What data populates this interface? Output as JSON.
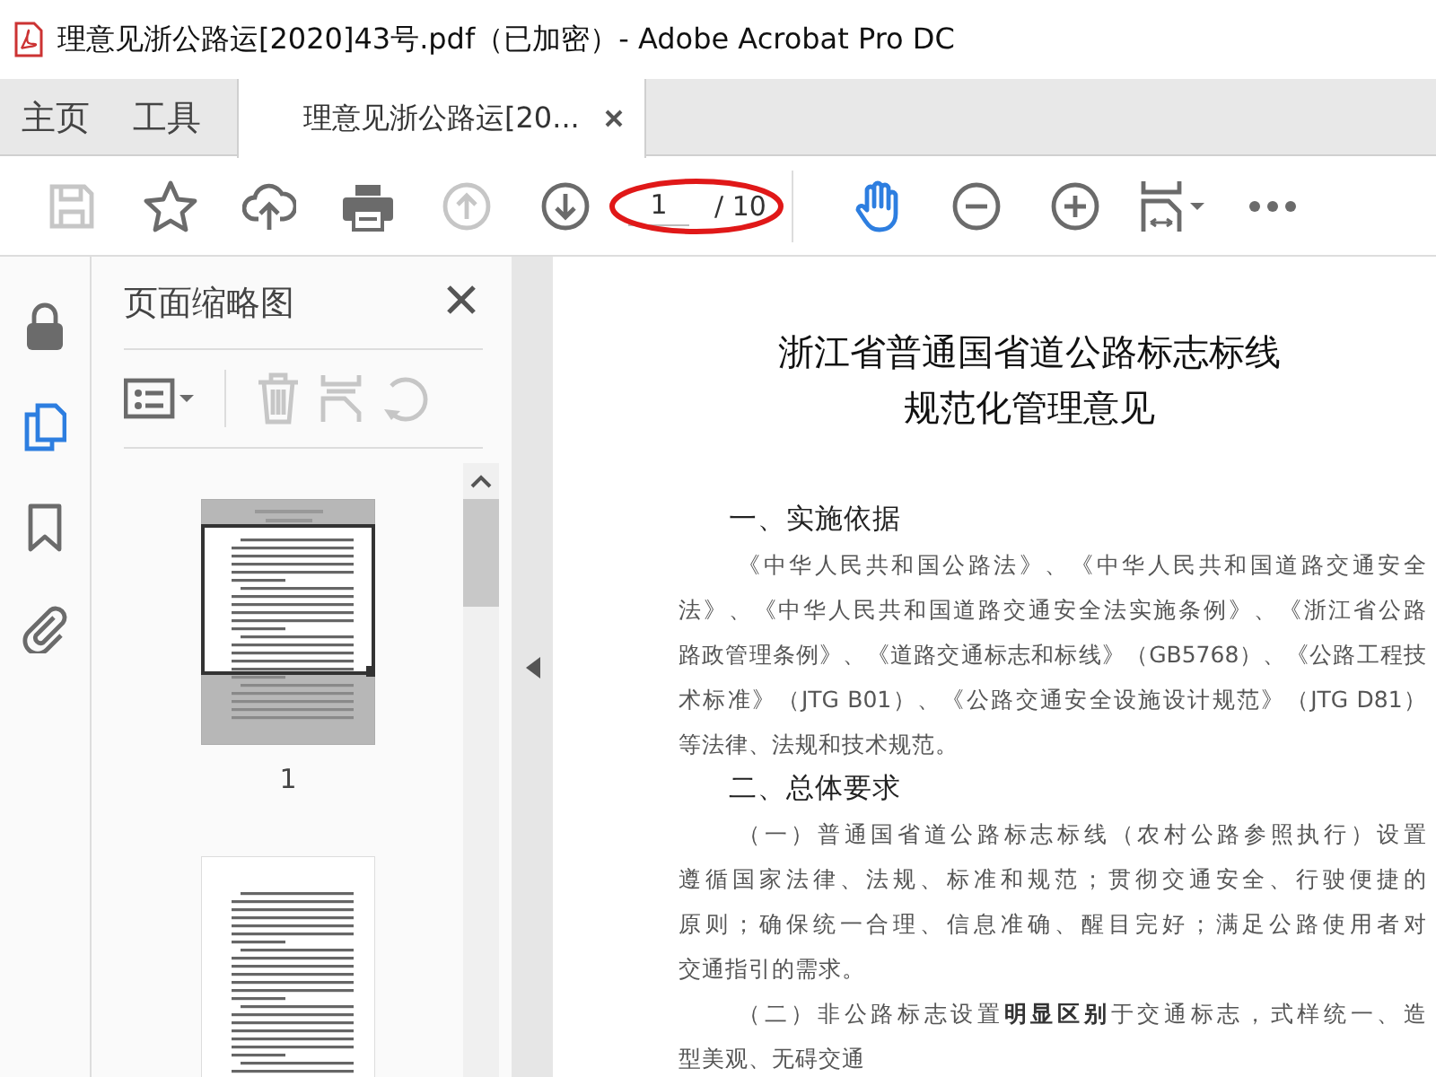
{
  "window": {
    "title": "理意见浙公路运[2020]43号.pdf（已加密）- Adobe Acrobat Pro DC"
  },
  "tabs": [
    {
      "label": "主页",
      "selected": false,
      "closable": false
    },
    {
      "label": "工具",
      "selected": false,
      "closable": false
    },
    {
      "label": "理意见浙公路运[20...",
      "selected": true,
      "closable": true
    }
  ],
  "toolbar": {
    "left_tools": [
      {
        "kind": "save",
        "disabled": true,
        "selected": false
      },
      {
        "kind": "star",
        "disabled": false,
        "selected": false
      },
      {
        "kind": "upload",
        "disabled": false,
        "selected": false
      },
      {
        "kind": "print",
        "disabled": false,
        "selected": false
      },
      {
        "kind": "prev",
        "disabled": true,
        "selected": false
      },
      {
        "kind": "next",
        "disabled": false,
        "selected": false
      }
    ],
    "page_field": {
      "value": "1",
      "total": "/ 10",
      "circled": true
    },
    "right_tools": [
      {
        "kind": "hand",
        "disabled": false,
        "selected": true
      },
      {
        "kind": "zoom_out",
        "disabled": false,
        "selected": false
      },
      {
        "kind": "zoom_in",
        "disabled": false,
        "selected": false
      },
      {
        "kind": "fit",
        "disabled": false,
        "selected": false
      },
      {
        "kind": "more",
        "disabled": false,
        "selected": false
      }
    ]
  },
  "rail": [
    {
      "kind": "lock",
      "selected": false
    },
    {
      "kind": "pages",
      "selected": true
    },
    {
      "kind": "bookmark",
      "selected": false
    },
    {
      "kind": "attachment",
      "selected": false
    }
  ],
  "thumbnail_panel": {
    "title": "页面缩略图",
    "tools": [
      {
        "kind": "options",
        "disabled": false
      },
      {
        "kind": "delete",
        "disabled": true
      },
      {
        "kind": "extract",
        "disabled": true
      },
      {
        "kind": "rotate",
        "disabled": true
      }
    ],
    "thumbnails": [
      {
        "label": "1",
        "selected": true
      },
      {
        "selected": false
      }
    ]
  },
  "document": {
    "title": [
      "浙江省普通国省道公路标志标线",
      "规范化管理意见"
    ],
    "sections": [
      {
        "kind": "heading",
        "text": "一、实施依据"
      },
      {
        "kind": "paragraph",
        "lines": [
          "《中华人民共和国公路法》、《中华人民共和国道路交通安全",
          "法》、《中华人民共和国道路交通安全法实施条例》、《浙江省公路",
          "路政管理条例》、《道路交通标志和标线》（GB5768）、《公路工程技",
          "术标准》（JTG B01）、《公路交通安全设施设计规范》（JTG D81）",
          "等法律、法规和技术规范。"
        ]
      },
      {
        "kind": "heading",
        "text": "二、总体要求"
      },
      {
        "kind": "paragraph",
        "lines": [
          "（一）普通国省道公路标志标线（农村公路参照执行）设置",
          "遵循国家法律、法规、标准和规范；贯彻交通安全、行驶便捷的",
          "原则；确保统一合理、信息准确、醒目完好；满足公路使用者对",
          "交通指引的需求。"
        ]
      },
      {
        "kind": "paragraph",
        "lines": [
          "（二）非公路标志设置**明显区别**于交通标志，式样统一、造",
          "型美观、无碍交通"
        ]
      }
    ]
  }
}
